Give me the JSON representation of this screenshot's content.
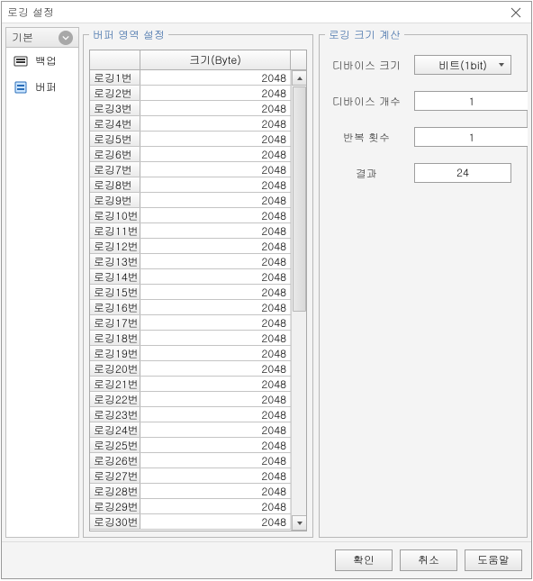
{
  "window": {
    "title": "로깅 설정",
    "close_glyph": "✕"
  },
  "sidebar": {
    "header": "기본",
    "items": [
      {
        "icon": "backup-icon",
        "label": "백업"
      },
      {
        "icon": "buffer-icon",
        "label": "버퍼"
      }
    ]
  },
  "buffer_panel": {
    "legend": "버퍼 영역 설정",
    "col_size": "크기(Byte)",
    "rows": [
      {
        "name": "로깅1번",
        "size": 2048
      },
      {
        "name": "로깅2번",
        "size": 2048
      },
      {
        "name": "로깅3번",
        "size": 2048
      },
      {
        "name": "로깅4번",
        "size": 2048
      },
      {
        "name": "로깅5번",
        "size": 2048
      },
      {
        "name": "로깅6번",
        "size": 2048
      },
      {
        "name": "로깅7번",
        "size": 2048
      },
      {
        "name": "로깅8번",
        "size": 2048
      },
      {
        "name": "로깅9번",
        "size": 2048
      },
      {
        "name": "로깅10번",
        "size": 2048
      },
      {
        "name": "로깅11번",
        "size": 2048
      },
      {
        "name": "로깅12번",
        "size": 2048
      },
      {
        "name": "로깅13번",
        "size": 2048
      },
      {
        "name": "로깅14번",
        "size": 2048
      },
      {
        "name": "로깅15번",
        "size": 2048
      },
      {
        "name": "로깅16번",
        "size": 2048
      },
      {
        "name": "로깅17번",
        "size": 2048
      },
      {
        "name": "로깅18번",
        "size": 2048
      },
      {
        "name": "로깅19번",
        "size": 2048
      },
      {
        "name": "로깅20번",
        "size": 2048
      },
      {
        "name": "로깅21번",
        "size": 2048
      },
      {
        "name": "로깅22번",
        "size": 2048
      },
      {
        "name": "로깅23번",
        "size": 2048
      },
      {
        "name": "로깅24번",
        "size": 2048
      },
      {
        "name": "로깅25번",
        "size": 2048
      },
      {
        "name": "로깅26번",
        "size": 2048
      },
      {
        "name": "로깅27번",
        "size": 2048
      },
      {
        "name": "로깅28번",
        "size": 2048
      },
      {
        "name": "로깅29번",
        "size": 2048
      },
      {
        "name": "로깅30번",
        "size": 2048
      }
    ]
  },
  "calc_panel": {
    "legend": "로깅 크기 계산",
    "device_size_label": "디바이스 크기",
    "device_size_value": "비트(1bit)",
    "device_count_label": "디바이스 개수",
    "device_count_value": "1",
    "repeat_label": "반복 횟수",
    "repeat_value": "1",
    "result_label": "결과",
    "result_value": "24"
  },
  "footer": {
    "ok": "확인",
    "cancel": "취소",
    "help": "도움말"
  }
}
